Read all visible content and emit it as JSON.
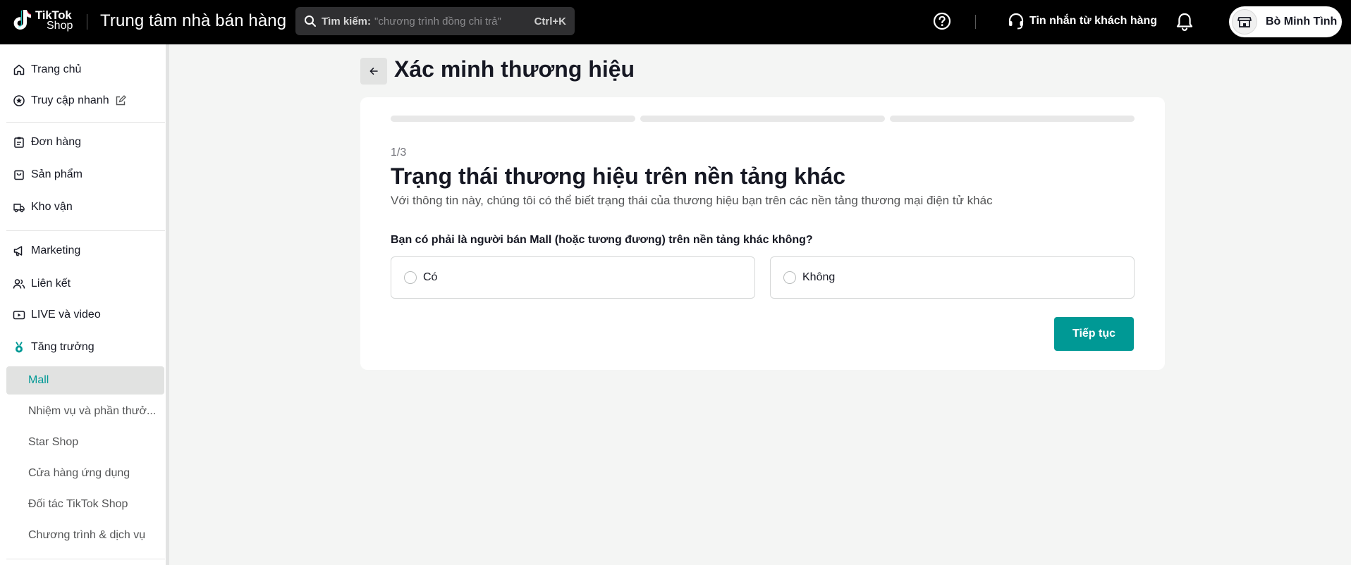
{
  "header": {
    "logo_line1": "TikTok",
    "logo_line2": "Shop",
    "app_title": "Trung tâm nhà bán hàng",
    "search": {
      "label": "Tìm kiếm:",
      "placeholder": "\"chương trình đồng chi trả\"",
      "shortcut": "Ctrl+K"
    },
    "customer_messages": "Tin nhắn từ khách hàng",
    "user_name": "Bò Minh Tình"
  },
  "sidebar": {
    "items": [
      {
        "label": "Trang chủ",
        "icon": "home-icon"
      },
      {
        "label": "Truy cập nhanh",
        "icon": "star-circle-icon"
      },
      {
        "label": "Đơn hàng",
        "icon": "clipboard-icon"
      },
      {
        "label": "Sản phẩm",
        "icon": "bag-icon"
      },
      {
        "label": "Kho vận",
        "icon": "truck-icon"
      },
      {
        "label": "Marketing",
        "icon": "megaphone-icon"
      },
      {
        "label": "Liên kết",
        "icon": "people-icon"
      },
      {
        "label": "LIVE và video",
        "icon": "video-icon"
      },
      {
        "label": "Tăng trưởng",
        "icon": "medal-icon"
      }
    ],
    "subitems": [
      {
        "label": "Mall",
        "active": true
      },
      {
        "label": "Nhiệm vụ và phần thưở..."
      },
      {
        "label": "Star Shop"
      },
      {
        "label": "Cửa hàng ứng dụng"
      },
      {
        "label": "Đối tác TikTok Shop"
      },
      {
        "label": "Chương trình & dịch vụ"
      }
    ]
  },
  "main": {
    "page_title": "Xác minh thương hiệu",
    "step": "1/3",
    "card_title": "Trạng thái thương hiệu trên nền tảng khác",
    "card_subtitle": "Với thông tin này, chúng tôi có thể biết trạng thái của thương hiệu bạn trên các nền tảng thương mại điện tử khác",
    "question": "Bạn có phải là người bán Mall (hoặc tương đương) trên nền tảng khác không?",
    "options": [
      "Có",
      "Không"
    ],
    "continue_label": "Tiếp tục",
    "progress_steps": 3,
    "progress_current": 1
  },
  "colors": {
    "accent": "#009995",
    "topbar": "#000000",
    "background": "#f4f5f4"
  }
}
